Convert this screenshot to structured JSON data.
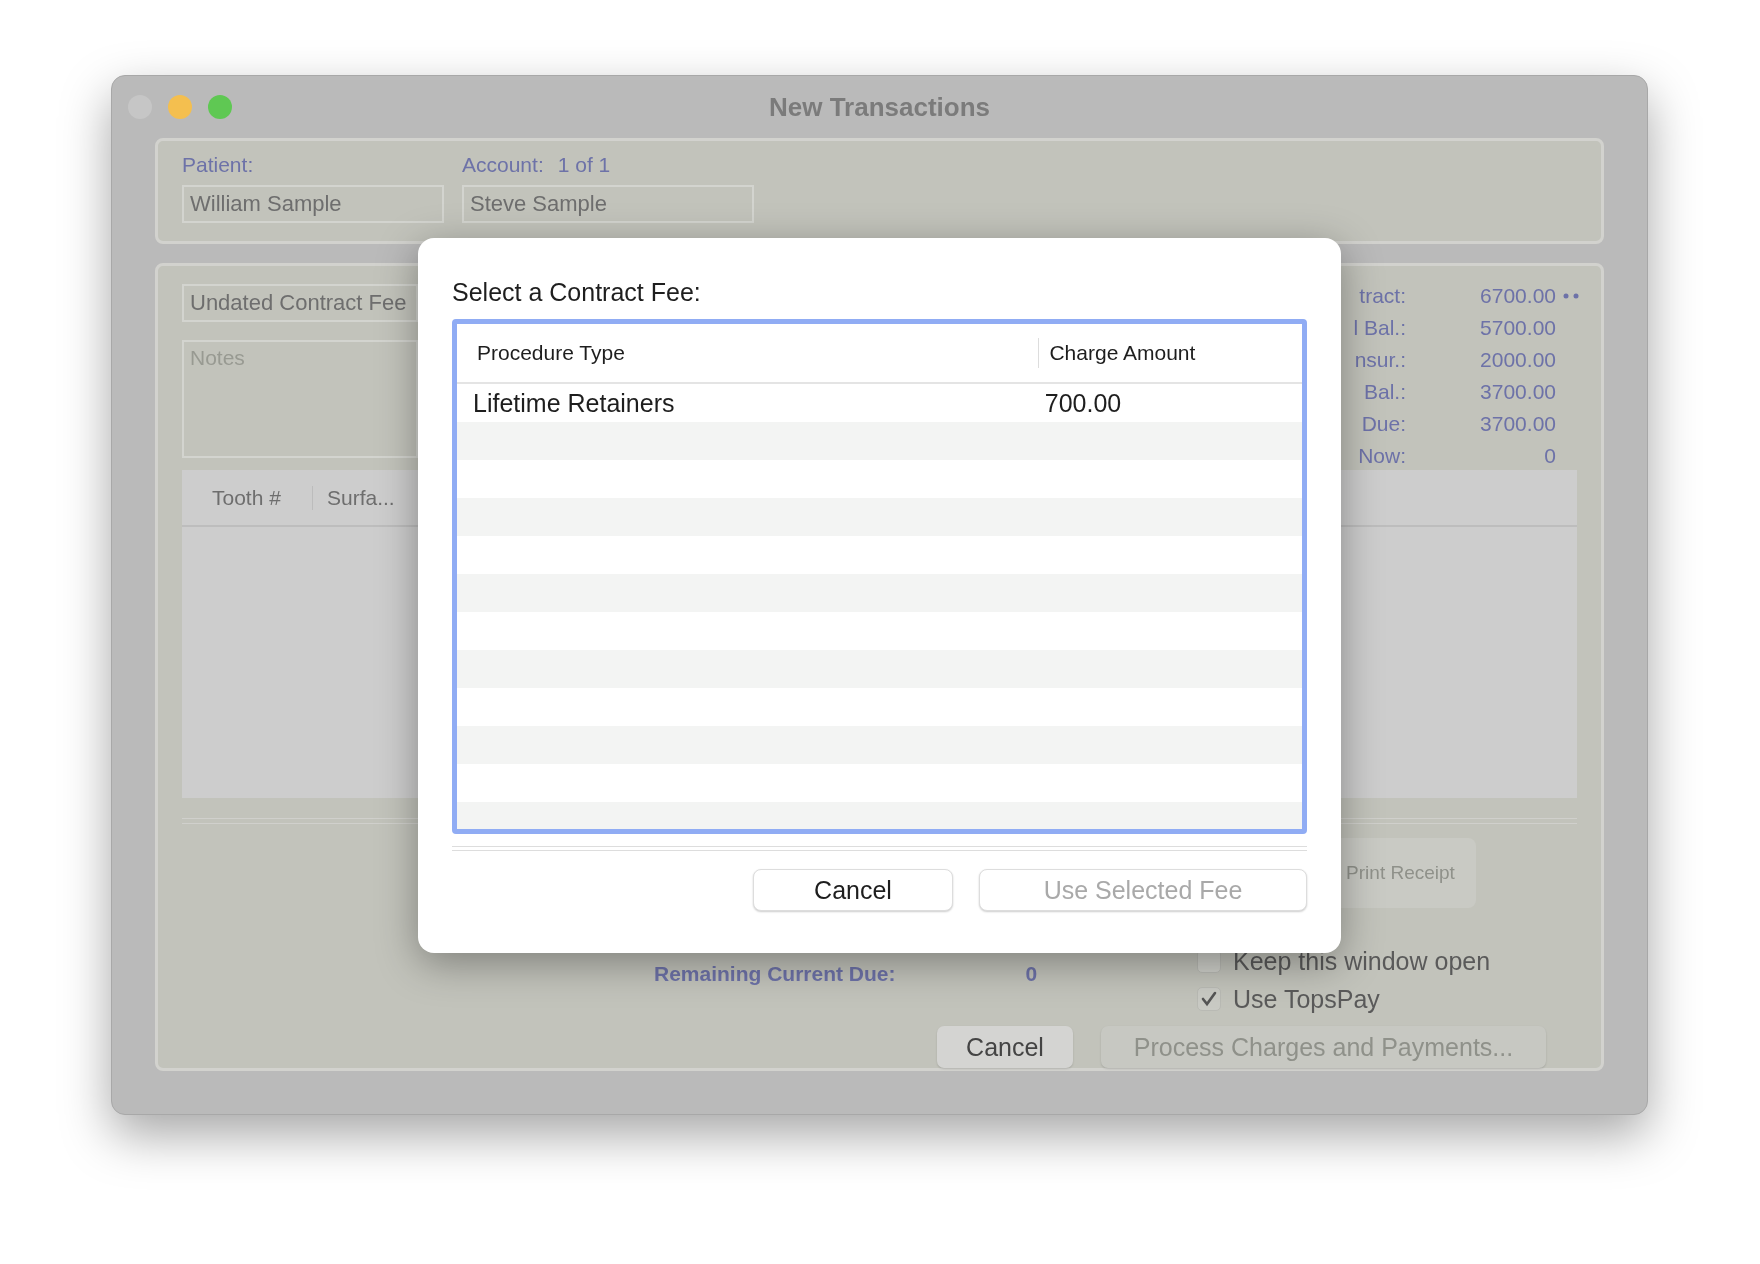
{
  "window": {
    "title": "New Transactions"
  },
  "patient": {
    "label": "Patient:",
    "value": "William Sample"
  },
  "account": {
    "label": "Account:",
    "count": "1 of 1",
    "value": "Steve Sample"
  },
  "contract_field": {
    "value": "Undated Contract Fee"
  },
  "notes": {
    "placeholder": "Notes"
  },
  "summary": [
    {
      "label": "tract:",
      "value": "6700.00"
    },
    {
      "label": "l Bal.:",
      "value": "5700.00"
    },
    {
      "label": "nsur.:",
      "value": "2000.00"
    },
    {
      "label": "Bal.:",
      "value": "3700.00"
    },
    {
      "label": "Due:",
      "value": "3700.00"
    },
    {
      "label": "Now:",
      "value": "0"
    }
  ],
  "table": {
    "columns": [
      "Tooth #",
      "Surfa..."
    ]
  },
  "remaining": {
    "label": "Remaining Current Due:",
    "value": "0"
  },
  "print_button": {
    "label": "Print Receipt",
    "disabled": true
  },
  "options": [
    {
      "label": "Keep this window open",
      "checked": false
    },
    {
      "label": "Use TopsPay",
      "checked": true
    }
  ],
  "buttons": [
    {
      "label": "Cancel",
      "disabled": false
    },
    {
      "label": "Process Charges and Payments...",
      "disabled": true
    }
  ],
  "dialog": {
    "title": "Select a Contract Fee:",
    "columns": [
      "Procedure Type",
      "Charge Amount"
    ],
    "rows": [
      {
        "procedure": "Lifetime Retainers",
        "amount": "700.00"
      }
    ],
    "buttons": [
      {
        "label": "Cancel",
        "disabled": false
      },
      {
        "label": "Use Selected Fee",
        "disabled": true
      }
    ]
  }
}
